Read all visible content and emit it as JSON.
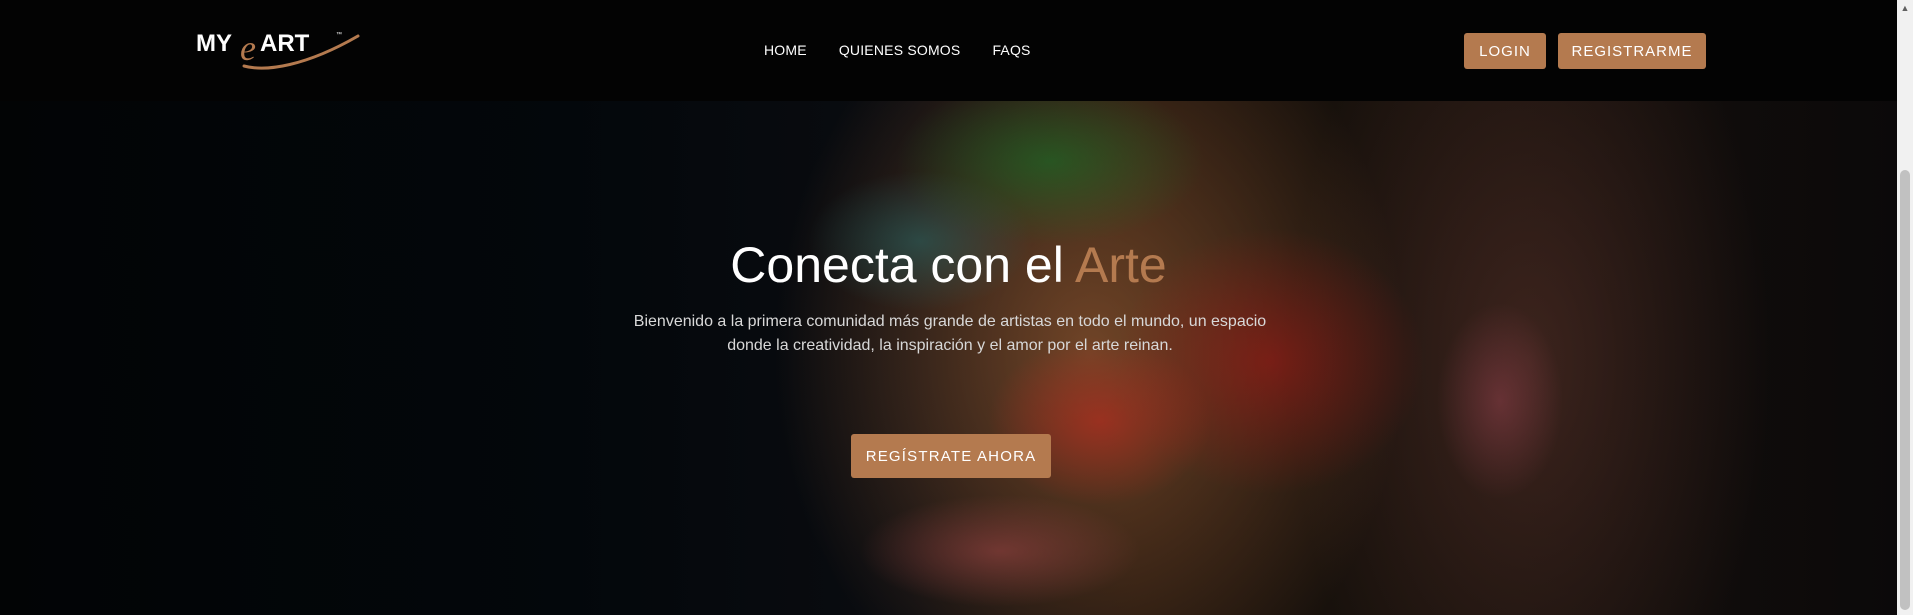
{
  "brand": {
    "logo_text_left": "MY",
    "logo_text_e": "e",
    "logo_text_right": "ART",
    "logo_tm": "™"
  },
  "nav": {
    "items": [
      {
        "label": "HOME"
      },
      {
        "label": "QUIENES SOMOS"
      },
      {
        "label": "FAQS"
      }
    ],
    "login_label": "LOGIN",
    "register_label": "REGISTRARME"
  },
  "hero": {
    "title_prefix": "Conecta con el ",
    "title_accent": "Arte",
    "text": "Bienvenido a la primera comunidad más grande de artistas en todo el mundo, un espacio donde la creatividad, la inspiración y el amor por el arte reinan.",
    "cta_label": "REGÍSTRATE AHORA"
  },
  "colors": {
    "accent": "#b47a4f",
    "nav_bg": "#030303"
  }
}
